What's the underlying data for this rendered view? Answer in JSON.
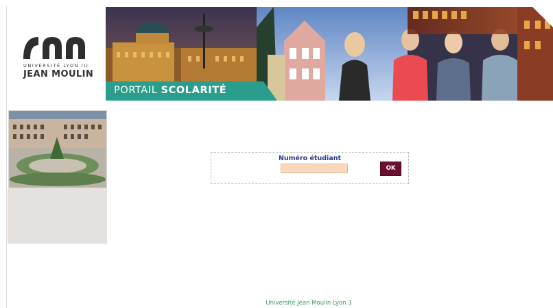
{
  "header": {
    "logo": {
      "university_line": "UNIVERSITÉ LYON III",
      "name": "JEAN MOULIN"
    },
    "banner": {
      "portail_text_light": "PORTAIL ",
      "portail_text_bold": "SCOLARITÉ",
      "accent_color": "#2a9d8c"
    }
  },
  "sidebar": {
    "photo": "campus-courtyard-photo"
  },
  "login": {
    "label": "Numéro étudiant",
    "input_value": "",
    "input_placeholder": "",
    "submit_label": "OK",
    "submit_color": "#6b0f30",
    "input_color": "#fbd7be"
  },
  "footer": {
    "text": "Université Jean Moulin Lyon 3",
    "color": "#3d9b57"
  }
}
